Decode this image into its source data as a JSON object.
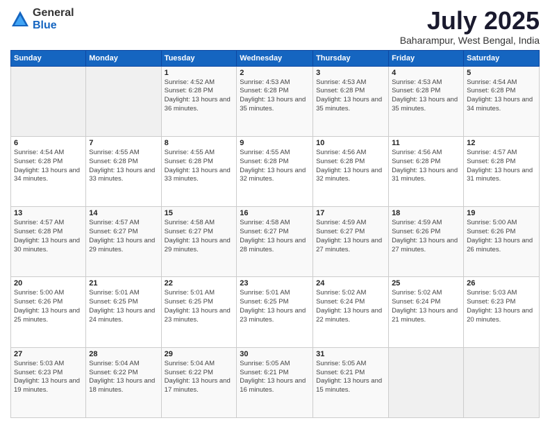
{
  "logo": {
    "general": "General",
    "blue": "Blue"
  },
  "header": {
    "title": "July 2025",
    "subtitle": "Baharampur, West Bengal, India"
  },
  "weekdays": [
    "Sunday",
    "Monday",
    "Tuesday",
    "Wednesday",
    "Thursday",
    "Friday",
    "Saturday"
  ],
  "weeks": [
    [
      {
        "day": "",
        "sunrise": "",
        "sunset": "",
        "daylight": ""
      },
      {
        "day": "",
        "sunrise": "",
        "sunset": "",
        "daylight": ""
      },
      {
        "day": "1",
        "sunrise": "Sunrise: 4:52 AM",
        "sunset": "Sunset: 6:28 PM",
        "daylight": "Daylight: 13 hours and 36 minutes."
      },
      {
        "day": "2",
        "sunrise": "Sunrise: 4:53 AM",
        "sunset": "Sunset: 6:28 PM",
        "daylight": "Daylight: 13 hours and 35 minutes."
      },
      {
        "day": "3",
        "sunrise": "Sunrise: 4:53 AM",
        "sunset": "Sunset: 6:28 PM",
        "daylight": "Daylight: 13 hours and 35 minutes."
      },
      {
        "day": "4",
        "sunrise": "Sunrise: 4:53 AM",
        "sunset": "Sunset: 6:28 PM",
        "daylight": "Daylight: 13 hours and 35 minutes."
      },
      {
        "day": "5",
        "sunrise": "Sunrise: 4:54 AM",
        "sunset": "Sunset: 6:28 PM",
        "daylight": "Daylight: 13 hours and 34 minutes."
      }
    ],
    [
      {
        "day": "6",
        "sunrise": "Sunrise: 4:54 AM",
        "sunset": "Sunset: 6:28 PM",
        "daylight": "Daylight: 13 hours and 34 minutes."
      },
      {
        "day": "7",
        "sunrise": "Sunrise: 4:55 AM",
        "sunset": "Sunset: 6:28 PM",
        "daylight": "Daylight: 13 hours and 33 minutes."
      },
      {
        "day": "8",
        "sunrise": "Sunrise: 4:55 AM",
        "sunset": "Sunset: 6:28 PM",
        "daylight": "Daylight: 13 hours and 33 minutes."
      },
      {
        "day": "9",
        "sunrise": "Sunrise: 4:55 AM",
        "sunset": "Sunset: 6:28 PM",
        "daylight": "Daylight: 13 hours and 32 minutes."
      },
      {
        "day": "10",
        "sunrise": "Sunrise: 4:56 AM",
        "sunset": "Sunset: 6:28 PM",
        "daylight": "Daylight: 13 hours and 32 minutes."
      },
      {
        "day": "11",
        "sunrise": "Sunrise: 4:56 AM",
        "sunset": "Sunset: 6:28 PM",
        "daylight": "Daylight: 13 hours and 31 minutes."
      },
      {
        "day": "12",
        "sunrise": "Sunrise: 4:57 AM",
        "sunset": "Sunset: 6:28 PM",
        "daylight": "Daylight: 13 hours and 31 minutes."
      }
    ],
    [
      {
        "day": "13",
        "sunrise": "Sunrise: 4:57 AM",
        "sunset": "Sunset: 6:28 PM",
        "daylight": "Daylight: 13 hours and 30 minutes."
      },
      {
        "day": "14",
        "sunrise": "Sunrise: 4:57 AM",
        "sunset": "Sunset: 6:27 PM",
        "daylight": "Daylight: 13 hours and 29 minutes."
      },
      {
        "day": "15",
        "sunrise": "Sunrise: 4:58 AM",
        "sunset": "Sunset: 6:27 PM",
        "daylight": "Daylight: 13 hours and 29 minutes."
      },
      {
        "day": "16",
        "sunrise": "Sunrise: 4:58 AM",
        "sunset": "Sunset: 6:27 PM",
        "daylight": "Daylight: 13 hours and 28 minutes."
      },
      {
        "day": "17",
        "sunrise": "Sunrise: 4:59 AM",
        "sunset": "Sunset: 6:27 PM",
        "daylight": "Daylight: 13 hours and 27 minutes."
      },
      {
        "day": "18",
        "sunrise": "Sunrise: 4:59 AM",
        "sunset": "Sunset: 6:26 PM",
        "daylight": "Daylight: 13 hours and 27 minutes."
      },
      {
        "day": "19",
        "sunrise": "Sunrise: 5:00 AM",
        "sunset": "Sunset: 6:26 PM",
        "daylight": "Daylight: 13 hours and 26 minutes."
      }
    ],
    [
      {
        "day": "20",
        "sunrise": "Sunrise: 5:00 AM",
        "sunset": "Sunset: 6:26 PM",
        "daylight": "Daylight: 13 hours and 25 minutes."
      },
      {
        "day": "21",
        "sunrise": "Sunrise: 5:01 AM",
        "sunset": "Sunset: 6:25 PM",
        "daylight": "Daylight: 13 hours and 24 minutes."
      },
      {
        "day": "22",
        "sunrise": "Sunrise: 5:01 AM",
        "sunset": "Sunset: 6:25 PM",
        "daylight": "Daylight: 13 hours and 23 minutes."
      },
      {
        "day": "23",
        "sunrise": "Sunrise: 5:01 AM",
        "sunset": "Sunset: 6:25 PM",
        "daylight": "Daylight: 13 hours and 23 minutes."
      },
      {
        "day": "24",
        "sunrise": "Sunrise: 5:02 AM",
        "sunset": "Sunset: 6:24 PM",
        "daylight": "Daylight: 13 hours and 22 minutes."
      },
      {
        "day": "25",
        "sunrise": "Sunrise: 5:02 AM",
        "sunset": "Sunset: 6:24 PM",
        "daylight": "Daylight: 13 hours and 21 minutes."
      },
      {
        "day": "26",
        "sunrise": "Sunrise: 5:03 AM",
        "sunset": "Sunset: 6:23 PM",
        "daylight": "Daylight: 13 hours and 20 minutes."
      }
    ],
    [
      {
        "day": "27",
        "sunrise": "Sunrise: 5:03 AM",
        "sunset": "Sunset: 6:23 PM",
        "daylight": "Daylight: 13 hours and 19 minutes."
      },
      {
        "day": "28",
        "sunrise": "Sunrise: 5:04 AM",
        "sunset": "Sunset: 6:22 PM",
        "daylight": "Daylight: 13 hours and 18 minutes."
      },
      {
        "day": "29",
        "sunrise": "Sunrise: 5:04 AM",
        "sunset": "Sunset: 6:22 PM",
        "daylight": "Daylight: 13 hours and 17 minutes."
      },
      {
        "day": "30",
        "sunrise": "Sunrise: 5:05 AM",
        "sunset": "Sunset: 6:21 PM",
        "daylight": "Daylight: 13 hours and 16 minutes."
      },
      {
        "day": "31",
        "sunrise": "Sunrise: 5:05 AM",
        "sunset": "Sunset: 6:21 PM",
        "daylight": "Daylight: 13 hours and 15 minutes."
      },
      {
        "day": "",
        "sunrise": "",
        "sunset": "",
        "daylight": ""
      },
      {
        "day": "",
        "sunrise": "",
        "sunset": "",
        "daylight": ""
      }
    ]
  ]
}
